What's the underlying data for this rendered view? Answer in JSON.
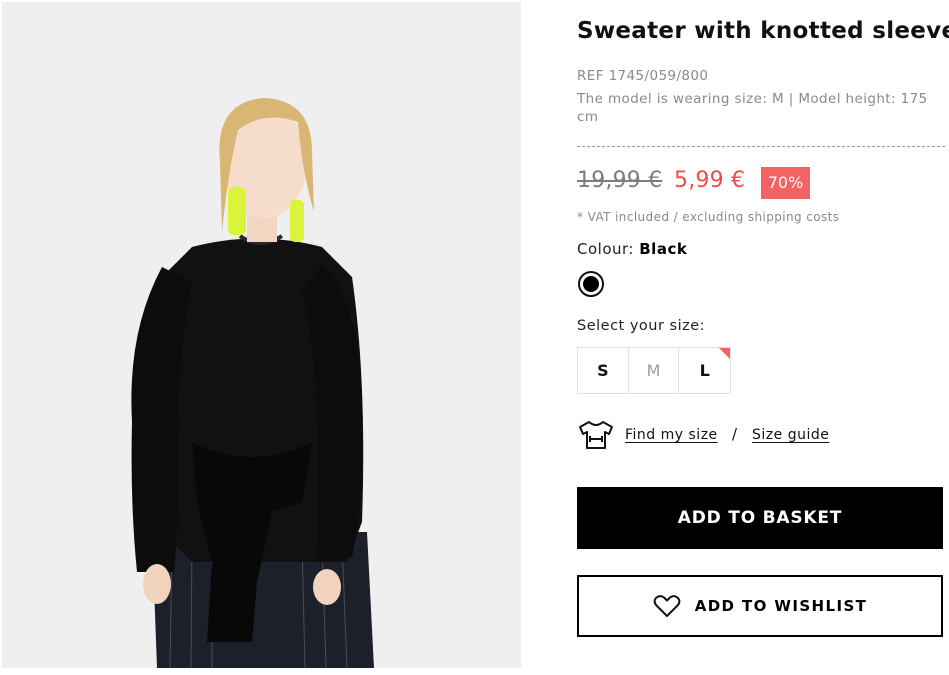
{
  "product": {
    "title": "Sweater with knotted sleeves",
    "ref": "REF 1745/059/800",
    "model_info": "The model is wearing size: M | Model height: 175 cm",
    "image_alt": "model-wearing-black-sweater"
  },
  "pricing": {
    "old_price": "19,99 €",
    "new_price": "5,99 €",
    "discount": "70%",
    "vat_note": "* VAT included / excluding shipping costs",
    "sale_color": "#ee4b4b",
    "badge_color": "#f46363"
  },
  "colour": {
    "label": "Colour:",
    "selected": "Black",
    "swatches": [
      {
        "name": "Black",
        "hex": "#000000"
      }
    ]
  },
  "sizes": {
    "label": "Select your size:",
    "options": [
      {
        "label": "S",
        "available": true
      },
      {
        "label": "M",
        "available": false
      },
      {
        "label": "L",
        "available": true,
        "flag": "last-units"
      }
    ]
  },
  "links": {
    "find_my_size": "Find my size",
    "separator": "/",
    "size_guide": "Size guide",
    "icon": "tshirt-measure-icon"
  },
  "actions": {
    "add_to_basket": "ADD TO BASKET",
    "add_to_wishlist": "ADD TO WISHLIST",
    "wishlist_icon": "heart-icon"
  }
}
